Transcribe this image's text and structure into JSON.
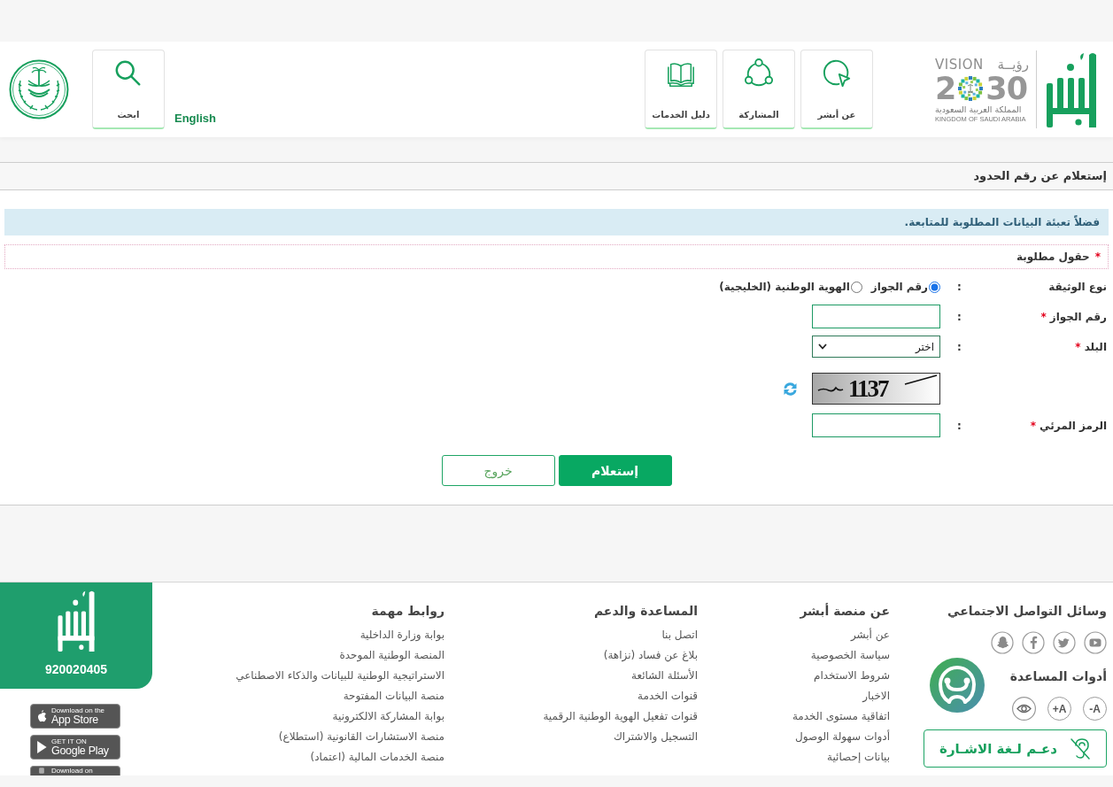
{
  "header": {
    "vision_logo": {
      "word_ar": "رؤيــة",
      "word_en": "VISION",
      "year_head": "2",
      "year_tail": "30",
      "country_ar": "المملكة العربية السعودية",
      "country_en": "KINGDOM OF SAUDI ARABIA"
    },
    "nav": [
      {
        "kind": "about",
        "label": "عن أبشر"
      },
      {
        "kind": "participation",
        "label": "المشاركة"
      },
      {
        "kind": "guide",
        "label": "دليل الخدمات"
      }
    ],
    "language_link": "English",
    "search": {
      "label": "ابحث"
    }
  },
  "page_title": "إستعلام عن رقم الحدود",
  "alert": "فضلاً تعبئة البيانات المطلوبة للمتابعة.",
  "required_note": {
    "mark": "*",
    "text": "حقول مطلوبة"
  },
  "form": {
    "rows": [
      {
        "kind": "radio",
        "label": "نوع الوثيقة",
        "separator": ":",
        "options": [
          {
            "label": "رقم الجواز",
            "selected": true
          },
          {
            "label": "الهوية الوطنية (الخليجية)",
            "selected": false
          }
        ]
      },
      {
        "kind": "text",
        "label": "رقم الجواز",
        "mark": "*",
        "separator": ":"
      },
      {
        "kind": "select",
        "label": "البلد",
        "mark": "*",
        "separator": ":",
        "value": "اختر"
      },
      {
        "kind": "captcha",
        "code": "1137"
      },
      {
        "kind": "text",
        "label": "الرمز المرئي",
        "mark": "*",
        "separator": ":"
      }
    ],
    "buttons": [
      {
        "kind": "primary",
        "label": "إستعلام"
      },
      {
        "kind": "secondary",
        "label": "خروج"
      }
    ]
  },
  "footer": {
    "social": {
      "title": "وسائل التواصل الاجتماعي",
      "icons": [
        {
          "kind": "youtube"
        },
        {
          "kind": "twitter"
        },
        {
          "kind": "facebook"
        },
        {
          "kind": "snapchat"
        }
      ]
    },
    "accessibility": {
      "title": "أدوات المساعدة",
      "tools": [
        {
          "kind": "text",
          "label": "-A"
        },
        {
          "kind": "text",
          "label": "+A"
        },
        {
          "kind": "eye"
        }
      ],
      "sign_language": "دعـم لـغة الاشـارة"
    },
    "columns": [
      {
        "title": "عن منصة أبشر",
        "links": [
          "عن أبشر",
          "سياسة الخصوصية",
          "شروط الاستخدام",
          "الاخبار",
          "اتفاقية مستوى الخدمة",
          "أدوات سهولة الوصول",
          "بيانات إحصائية"
        ]
      },
      {
        "title": "المساعدة والدعم",
        "links": [
          "اتصل بنا",
          "بلاغ عن فساد (نزاهة)",
          "الأسئلة الشائعة",
          "قنوات الخدمة",
          "قنوات تفعيل الهوية الوطنية الرقمية",
          "التسجيل والاشتراك"
        ]
      },
      {
        "title": "روابط مهمة",
        "links": [
          "بوابة وزارة الداخلية",
          "المنصة الوطنية الموحدة",
          "الاستراتيجية الوطنية للبيانات والذكاء الاصطناعي",
          "منصة البيانات المفتوحة",
          "بوابة المشاركة الالكترونية",
          "منصة الاستشارات القانونية (استطلاع)",
          "منصة الخدمات المالية (اعتماد)"
        ]
      }
    ],
    "contact": {
      "phone": "920020405"
    },
    "app_badges": [
      {
        "kind": "apple",
        "small": "Download on the",
        "large": "App Store"
      },
      {
        "kind": "google",
        "small": "GET IT ON",
        "large": "Google Play"
      },
      {
        "kind": "other",
        "small": "Download on"
      }
    ]
  }
}
